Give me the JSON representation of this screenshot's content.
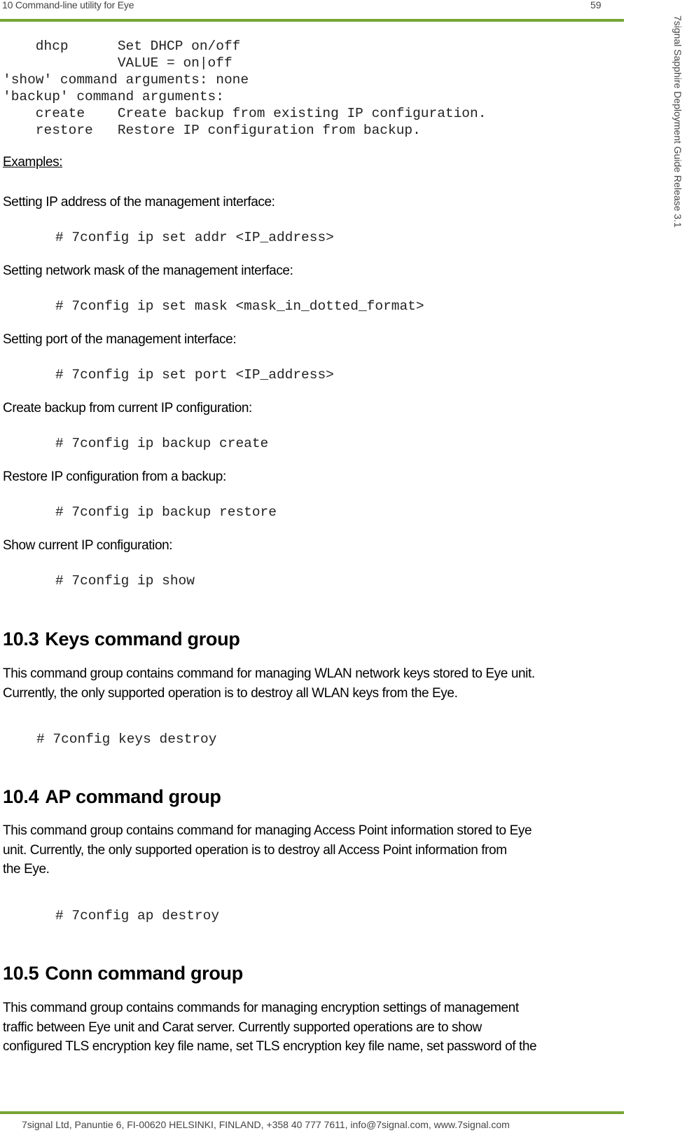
{
  "header": {
    "chapter": "10 Command-line utility for Eye",
    "page_number": "59",
    "side_title": "7signal Sapphire Deployment Guide Release 3.1"
  },
  "footer": {
    "text": "7signal Ltd, Panuntie 6, FI-00620 HELSINKI, FINLAND, +358 40 777 7611, info@7signal.com, www.7signal.com"
  },
  "colors": {
    "accent_rule": "#76A536"
  },
  "usage_block": [
    "    dhcp      Set DHCP on/off",
    "              VALUE = on|off",
    "'show' command arguments: none",
    "'backup' command arguments:",
    "    create    Create backup from existing IP configuration.",
    "    restore   Restore IP configuration from backup."
  ],
  "examples": {
    "heading": "Examples:",
    "items": [
      {
        "description": "Setting IP address of the management interface:",
        "command": "# 7config ip set addr <IP_address>"
      },
      {
        "description": "Setting network mask of the management interface:",
        "command": "# 7config ip set mask <mask_in_dotted_format>"
      },
      {
        "description": "Setting port of the management interface:",
        "command": "# 7config ip set port <IP_address>"
      },
      {
        "description": "Create backup from current IP configuration:",
        "command": "# 7config ip backup create"
      },
      {
        "description": "Restore IP configuration from a backup:",
        "command": "# 7config ip backup restore"
      },
      {
        "description": "Show current IP configuration:",
        "command": "# 7config ip show"
      }
    ]
  },
  "sections": [
    {
      "number": "10.3",
      "title": "Keys command group",
      "lines": [
        "This command group contains command for managing WLAN network keys stored to Eye unit.",
        "Currently, the only supported operation is to destroy all WLAN keys from the Eye."
      ],
      "command": "# 7config keys destroy"
    },
    {
      "number": "10.4",
      "title": "AP command group",
      "lines": [
        "This command group contains command for managing Access Point information stored to Eye",
        "unit. Currently, the only supported operation is to destroy all Access Point information from",
        "the Eye."
      ],
      "command": "# 7config ap destroy"
    },
    {
      "number": "10.5",
      "title": "Conn command group",
      "lines": [
        "This command group contains commands for managing encryption settings of management",
        "traffic between Eye unit and Carat server. Currently supported operations are to show",
        "configured TLS encryption key file name, set TLS encryption key file name, set password of the"
      ]
    }
  ]
}
